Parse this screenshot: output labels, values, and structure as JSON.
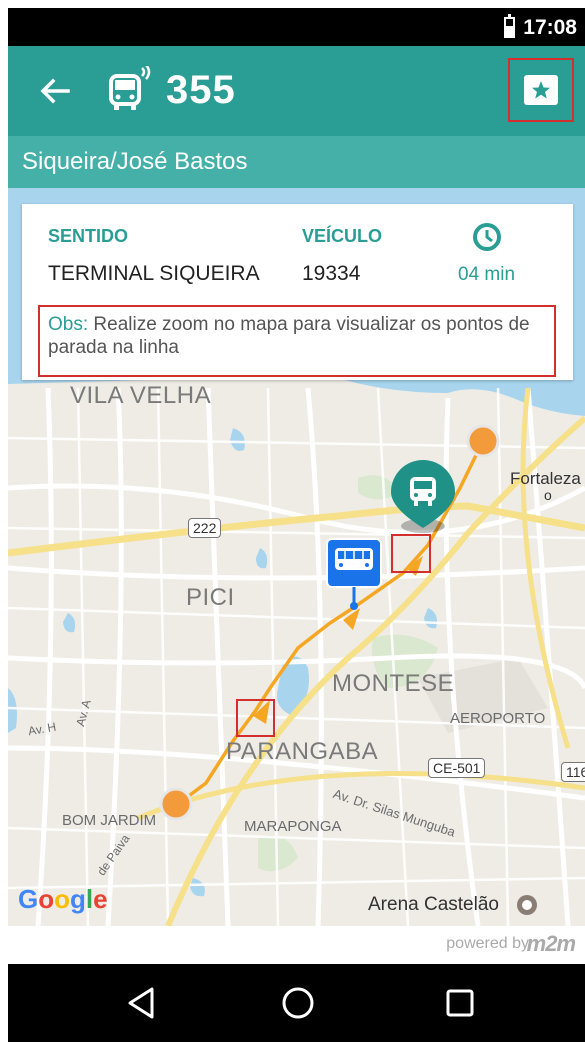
{
  "status": {
    "time": "17:08",
    "battery_level": 0.6
  },
  "header": {
    "back_icon": "arrow-left-icon",
    "bus_icon": "bus-signal-icon",
    "line_number": "355",
    "favorite_icon": "star-icon"
  },
  "route": {
    "name": "Siqueira/José Bastos"
  },
  "info": {
    "direction_label": "SENTIDO",
    "direction_value": "TERMINAL SIQUEIRA",
    "vehicle_label": "VEÍCULO",
    "vehicle_value": "19334",
    "time_icon": "clock-icon",
    "time_value": "04 min",
    "obs_label": "Obs:",
    "obs_text": " Realize zoom no mapa para visualizar os pontos de parada na linha"
  },
  "map": {
    "labels": {
      "vila_velha": "VILA VELHA",
      "fortaleza": "Fortaleza",
      "pici": "PICI",
      "montese": "MONTESE",
      "aeroporto": "AEROPORTO",
      "parangaba": "PARANGABA",
      "bom_jardim": "BOM JARDIM",
      "maraponga": "MARAPONGA",
      "arena": "Arena Castelão",
      "av_h": "Av. H",
      "av_a": "Av. A",
      "silas": "Av. Dr. Silas Munguba",
      "paiva": "de Paiva",
      "ce501": "CE-501",
      "r222": "222",
      "r116": "116",
      "google": "Google"
    },
    "colors": {
      "route": "#f5a623",
      "water": "#a8d4ee",
      "park": "#cde6c0",
      "road": "#ffffff",
      "highway": "#f6e08a"
    }
  },
  "footer": {
    "powered_by": "powered by",
    "brand": "m2m"
  },
  "navbar": {
    "back": "triangle-back-icon",
    "home": "circle-home-icon",
    "recent": "square-recent-icon"
  }
}
